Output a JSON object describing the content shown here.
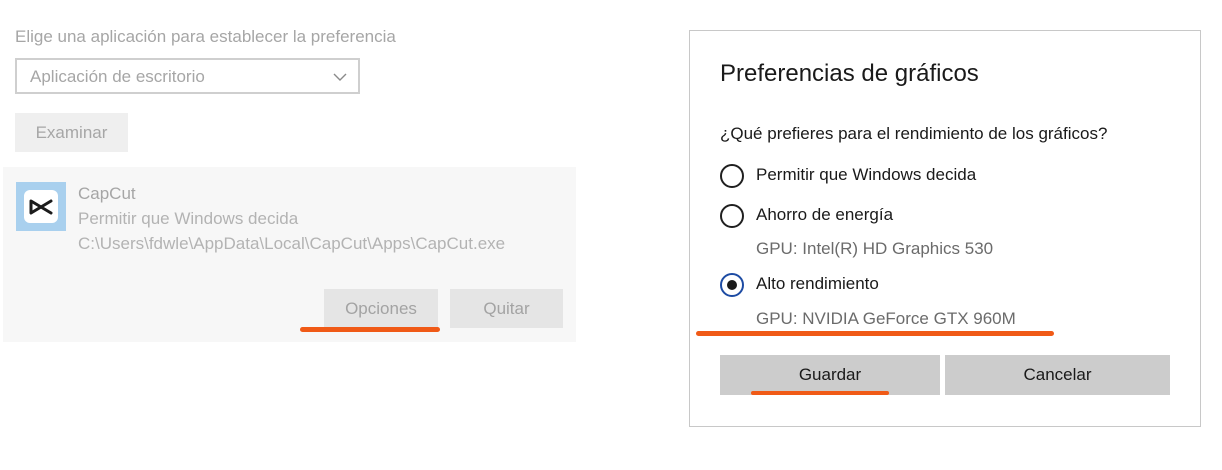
{
  "left": {
    "choose_label": "Elige una aplicación para establecer la preferencia",
    "app_type_select": {
      "value": "Aplicación de escritorio"
    },
    "browse_button": "Examinar",
    "app_entry": {
      "name": "CapCut",
      "preference": "Permitir que Windows decida",
      "path": "C:\\Users\\fdwle\\AppData\\Local\\CapCut\\Apps\\CapCut.exe",
      "options_button": "Opciones",
      "remove_button": "Quitar"
    }
  },
  "dialog": {
    "title": "Preferencias de gráficos",
    "question": "¿Qué prefieres para el rendimiento de los gráficos?",
    "options": [
      {
        "label": "Permitir que Windows decida",
        "selected": false
      },
      {
        "label": "Ahorro de energía",
        "gpu": "GPU: Intel(R) HD Graphics 530",
        "selected": false
      },
      {
        "label": "Alto rendimiento",
        "gpu": "GPU: NVIDIA GeForce GTX 960M",
        "selected": true
      }
    ],
    "save_button": "Guardar",
    "cancel_button": "Cancelar"
  },
  "colors": {
    "highlight_underline": "#f05a17",
    "dialog_button_bg": "#cccccc",
    "app_icon_bg": "#a9d0ee"
  },
  "icons": {
    "dropdown": "chevron-down-icon",
    "app": "capcut-app-icon"
  }
}
